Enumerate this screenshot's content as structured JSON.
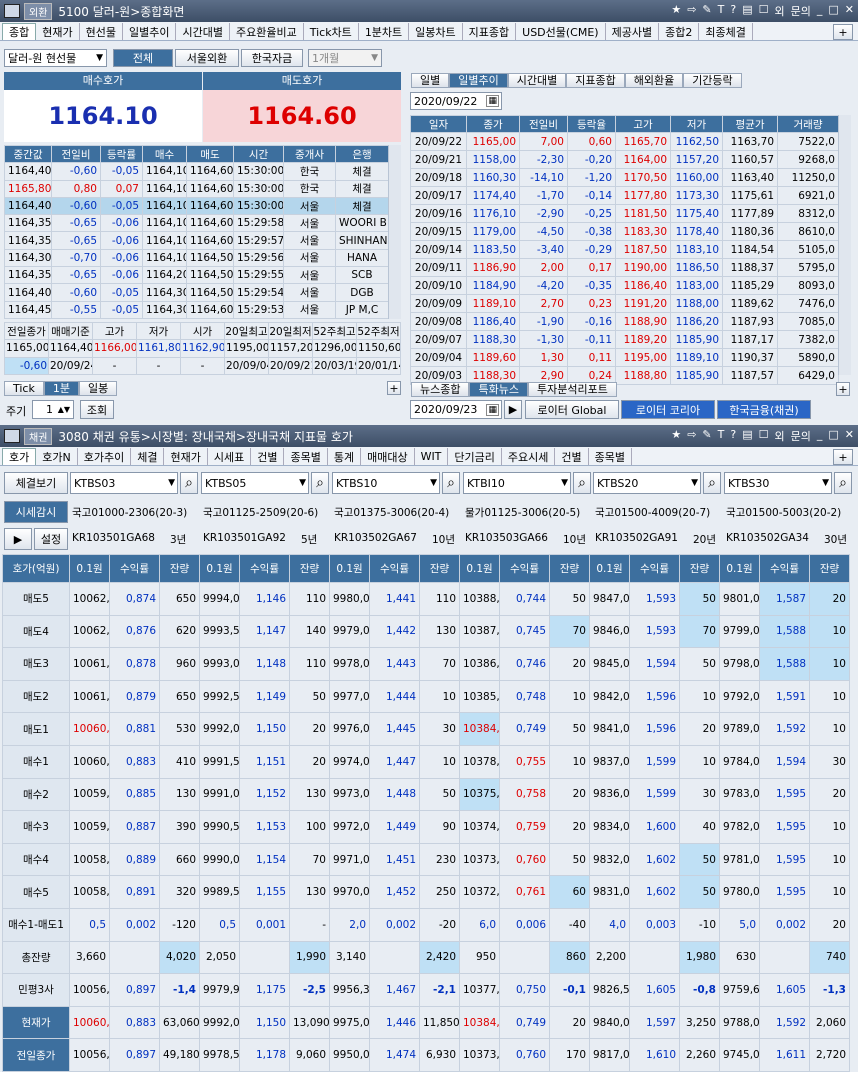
{
  "top": {
    "badge": "외환",
    "title": "5100 달러-원>종합화면",
    "icons": [
      "★",
      "⇨",
      "✎",
      "T",
      "?",
      "▤",
      "☐",
      "외",
      "문의",
      "_",
      "□",
      "✕"
    ],
    "tabs": [
      "종합",
      "현재가",
      "현선물",
      "일별추이",
      "시간대별",
      "주요환율비교",
      "Tick차트",
      "1분차트",
      "일봉차트",
      "지표종합",
      "USD선물(CME)",
      "제공사별",
      "종합2",
      "최종체결"
    ],
    "add": "+",
    "currency_select": "달러-원 현선물",
    "filters": [
      "전체",
      "서울외환",
      "한국자금"
    ],
    "period": "1개월",
    "bid_label": "매수호가",
    "ask_label": "매도호가",
    "bid": "1164.10",
    "ask": "1164.60",
    "ticks_headers": [
      "중간값",
      "전일비",
      "등락률",
      "매수",
      "매도",
      "시간",
      "중개사",
      "은행"
    ],
    "ticks": [
      [
        "1164,40",
        "-0,60",
        "-0,05",
        "1164,10",
        "1164,60",
        "15:30:00",
        "한국",
        "체결"
      ],
      [
        "1165,80",
        "0,80",
        "0,07",
        "1164,10",
        "1164,60",
        "15:30:00",
        "한국",
        "체결"
      ],
      [
        "1164,40",
        "-0,60",
        "-0,05",
        "1164,10",
        "1164,60",
        "15:30:00",
        "서울",
        "체결"
      ],
      [
        "1164,35",
        "-0,65",
        "-0,06",
        "1164,10",
        "1164,60",
        "15:29:58",
        "서울",
        "WOORI B"
      ],
      [
        "1164,35",
        "-0,65",
        "-0,06",
        "1164,10",
        "1164,60",
        "15:29:57",
        "서울",
        "SHINHAN"
      ],
      [
        "1164,30",
        "-0,70",
        "-0,06",
        "1164,10",
        "1164,50",
        "15:29:56",
        "서울",
        "HANA"
      ],
      [
        "1164,35",
        "-0,65",
        "-0,06",
        "1164,20",
        "1164,50",
        "15:29:55",
        "서울",
        "SCB"
      ],
      [
        "1164,40",
        "-0,60",
        "-0,05",
        "1164,30",
        "1164,50",
        "15:29:54",
        "서울",
        "DGB"
      ],
      [
        "1164,45",
        "-0,55",
        "-0,05",
        "1164,30",
        "1164,60",
        "15:29:53",
        "서울",
        "JP M,C"
      ]
    ],
    "summary_headers": [
      "전일종가",
      "매매기준",
      "고가",
      "저가",
      "시가",
      "20일최고",
      "20일최저",
      "52주최고",
      "52주최저"
    ],
    "summary_row1": [
      "1165,00",
      "1164,40",
      "1166,00",
      "1161,80",
      "1162,90",
      "1195,00",
      "1157,20",
      "1296,00",
      "1150,60"
    ],
    "summary_row2": [
      "-0,60",
      "20/09/24",
      "-",
      "-",
      "-",
      "20/09/04",
      "20/09/21",
      "20/03/19",
      "20/01/14"
    ],
    "bottom_tabs": [
      "Tick",
      "1분",
      "일봉"
    ],
    "cycle_label": "주기",
    "cycle_value": "1",
    "lookup": "조회",
    "right_tabs": [
      "일별",
      "일별추이",
      "시간대별",
      "지표종합",
      "해외환율",
      "기간등락"
    ],
    "date": "2020/09/22",
    "daily_headers": [
      "일자",
      "종가",
      "전일비",
      "등락율",
      "고가",
      "저가",
      "평균가",
      "거래량"
    ],
    "daily": [
      [
        "20/09/22",
        "1165,00",
        "7,00",
        "0,60",
        "1165,70",
        "1162,50",
        "1163,70",
        "7522,0"
      ],
      [
        "20/09/21",
        "1158,00",
        "-2,30",
        "-0,20",
        "1164,00",
        "1157,20",
        "1160,57",
        "9268,0"
      ],
      [
        "20/09/18",
        "1160,30",
        "-14,10",
        "-1,20",
        "1170,50",
        "1160,00",
        "1163,40",
        "11250,0"
      ],
      [
        "20/09/17",
        "1174,40",
        "-1,70",
        "-0,14",
        "1177,80",
        "1173,30",
        "1175,61",
        "6921,0"
      ],
      [
        "20/09/16",
        "1176,10",
        "-2,90",
        "-0,25",
        "1181,50",
        "1175,40",
        "1177,89",
        "8312,0"
      ],
      [
        "20/09/15",
        "1179,00",
        "-4,50",
        "-0,38",
        "1183,30",
        "1178,40",
        "1180,36",
        "8610,0"
      ],
      [
        "20/09/14",
        "1183,50",
        "-3,40",
        "-0,29",
        "1187,50",
        "1183,10",
        "1184,54",
        "5105,0"
      ],
      [
        "20/09/11",
        "1186,90",
        "2,00",
        "0,17",
        "1190,00",
        "1186,50",
        "1188,37",
        "5795,0"
      ],
      [
        "20/09/10",
        "1184,90",
        "-4,20",
        "-0,35",
        "1186,40",
        "1183,00",
        "1185,29",
        "8093,0"
      ],
      [
        "20/09/09",
        "1189,10",
        "2,70",
        "0,23",
        "1191,20",
        "1188,00",
        "1189,62",
        "7476,0"
      ],
      [
        "20/09/08",
        "1186,40",
        "-1,90",
        "-0,16",
        "1188,90",
        "1186,20",
        "1187,93",
        "7085,0"
      ],
      [
        "20/09/07",
        "1188,30",
        "-1,30",
        "-0,11",
        "1189,20",
        "1185,90",
        "1187,17",
        "7382,0"
      ],
      [
        "20/09/04",
        "1189,60",
        "1,30",
        "0,11",
        "1195,00",
        "1189,10",
        "1190,37",
        "5890,0"
      ],
      [
        "20/09/03",
        "1188,30",
        "2,90",
        "0,24",
        "1188,80",
        "1185,90",
        "1187,57",
        "6429,0"
      ]
    ],
    "news_tabs": [
      "뉴스종합",
      "특화뉴스",
      "투자분석리포트"
    ],
    "news_date": "2020/09/23",
    "news_sources": [
      "로이터 Global",
      "로이터 코리아",
      "한국금융(채권)"
    ]
  },
  "bond": {
    "badge": "채권",
    "title": "3080 채권 유통>시장별: 장내국채>장내국채 지표물 호가",
    "icons": [
      "★",
      "⇨",
      "✎",
      "T",
      "?",
      "▤",
      "☐",
      "외",
      "문의",
      "_",
      "□",
      "✕"
    ],
    "tabs": [
      "호가",
      "호가N",
      "호가추이",
      "체결",
      "현재가",
      "시세표",
      "건별",
      "종목별",
      "통계",
      "매매대상",
      "WIT",
      "단기금리",
      "주요시세",
      "건별",
      "종목별"
    ],
    "add": "+",
    "btn_settlement": "체결보기",
    "btn_monitor": "시세감시",
    "btn_setup": "설정",
    "play": "▶",
    "unit_label": "호가(억원)",
    "col_headers": [
      "0.1원",
      "수익률",
      "잔량"
    ],
    "row_labels": [
      "매도5",
      "매도4",
      "매도3",
      "매도2",
      "매도1",
      "매수1",
      "매수2",
      "매수3",
      "매수4",
      "매수5",
      "매수1-매도1",
      "총잔량",
      "민평3사",
      "현재가",
      "전일종가"
    ],
    "items": [
      {
        "code": "KTBS03",
        "name": "국고01000-2306(20-3)",
        "isin": "KR103501GA68",
        "tenor": "3년",
        "rows": [
          [
            "10062,5",
            "0,874",
            "650"
          ],
          [
            "10062,0",
            "0,876",
            "620"
          ],
          [
            "10061,5",
            "0,878",
            "960"
          ],
          [
            "10061,0",
            "0,879",
            "650"
          ],
          [
            "10060,5",
            "0,881",
            "530"
          ],
          [
            "10060,0",
            "0,883",
            "410"
          ],
          [
            "10059,5",
            "0,885",
            "130"
          ],
          [
            "10059,0",
            "0,887",
            "390"
          ],
          [
            "10058,5",
            "0,889",
            "660"
          ],
          [
            "10058,0",
            "0,891",
            "320"
          ],
          [
            "0,5",
            "0,002",
            "-120"
          ],
          [
            "3,660",
            "",
            "4,020"
          ],
          [
            "10056,1",
            "0,897",
            "-1,4"
          ],
          [
            "10060,0",
            "0,883",
            "63,060"
          ],
          [
            "10056,0",
            "0,897",
            "49,180"
          ]
        ]
      },
      {
        "code": "KTBS05",
        "name": "국고01125-2509(20-6)",
        "isin": "KR103501GA92",
        "tenor": "5년",
        "rows": [
          [
            "9994,0",
            "1,146",
            "110"
          ],
          [
            "9993,5",
            "1,147",
            "140"
          ],
          [
            "9993,0",
            "1,148",
            "110"
          ],
          [
            "9992,5",
            "1,149",
            "50"
          ],
          [
            "9992,0",
            "1,150",
            "20"
          ],
          [
            "9991,5",
            "1,151",
            "20"
          ],
          [
            "9991,0",
            "1,152",
            "130"
          ],
          [
            "9990,5",
            "1,153",
            "100"
          ],
          [
            "9990,0",
            "1,154",
            "70"
          ],
          [
            "9989,5",
            "1,155",
            "130"
          ],
          [
            "0,5",
            "0,001",
            "-"
          ],
          [
            "2,050",
            "",
            "1,990"
          ],
          [
            "9979,9",
            "1,175",
            "-2,5"
          ],
          [
            "9992,0",
            "1,150",
            "13,090"
          ],
          [
            "9978,5",
            "1,178",
            "9,060"
          ]
        ]
      },
      {
        "code": "KTBS10",
        "name": "국고01375-3006(20-4)",
        "isin": "KR103502GA67",
        "tenor": "10년",
        "rows": [
          [
            "9980,0",
            "1,441",
            "110"
          ],
          [
            "9979,0",
            "1,442",
            "130"
          ],
          [
            "9978,0",
            "1,443",
            "70"
          ],
          [
            "9977,0",
            "1,444",
            "10"
          ],
          [
            "9976,0",
            "1,445",
            "30"
          ],
          [
            "9974,0",
            "1,447",
            "10"
          ],
          [
            "9973,0",
            "1,448",
            "50"
          ],
          [
            "9972,0",
            "1,449",
            "90"
          ],
          [
            "9971,0",
            "1,451",
            "230"
          ],
          [
            "9970,0",
            "1,452",
            "250"
          ],
          [
            "2,0",
            "0,002",
            "-20"
          ],
          [
            "3,140",
            "",
            "2,420"
          ],
          [
            "9956,3",
            "1,467",
            "-2,1"
          ],
          [
            "9975,0",
            "1,446",
            "11,850"
          ],
          [
            "9950,0",
            "1,474",
            "6,930"
          ]
        ]
      },
      {
        "code": "KTBI10",
        "name": "물가01125-3006(20-5)",
        "isin": "KR103503GA66",
        "tenor": "10년",
        "rows": [
          [
            "10388,0",
            "0,744",
            "50"
          ],
          [
            "10387,0",
            "0,745",
            "70"
          ],
          [
            "10386,0",
            "0,746",
            "20"
          ],
          [
            "10385,0",
            "0,748",
            "10"
          ],
          [
            "10384,0",
            "0,749",
            "50"
          ],
          [
            "10378,0",
            "0,755",
            "10"
          ],
          [
            "10375,0",
            "0,758",
            "20"
          ],
          [
            "10374,0",
            "0,759",
            "20"
          ],
          [
            "10373,0",
            "0,760",
            "50"
          ],
          [
            "10372,0",
            "0,761",
            "60"
          ],
          [
            "6,0",
            "0,006",
            "-40"
          ],
          [
            "950",
            "",
            "860"
          ],
          [
            "10377,7",
            "0,750",
            "-0,1"
          ],
          [
            "10384,0",
            "0,749",
            "20"
          ],
          [
            "10373,0",
            "0,760",
            "170"
          ]
        ]
      },
      {
        "code": "KTBS20",
        "name": "국고01500-4009(20-7)",
        "isin": "KR103502GA91",
        "tenor": "20년",
        "rows": [
          [
            "9847,0",
            "1,593",
            "50"
          ],
          [
            "9846,0",
            "1,593",
            "70"
          ],
          [
            "9845,0",
            "1,594",
            "50"
          ],
          [
            "9842,0",
            "1,596",
            "10"
          ],
          [
            "9841,0",
            "1,596",
            "20"
          ],
          [
            "9837,0",
            "1,599",
            "10"
          ],
          [
            "9836,0",
            "1,599",
            "30"
          ],
          [
            "9834,0",
            "1,600",
            "40"
          ],
          [
            "9832,0",
            "1,602",
            "50"
          ],
          [
            "9831,0",
            "1,602",
            "50"
          ],
          [
            "4,0",
            "0,003",
            "-10"
          ],
          [
            "2,200",
            "",
            "1,980"
          ],
          [
            "9826,5",
            "1,605",
            "-0,8"
          ],
          [
            "9840,0",
            "1,597",
            "3,250"
          ],
          [
            "9817,0",
            "1,610",
            "2,260"
          ]
        ]
      },
      {
        "code": "KTBS30",
        "name": "국고01500-5003(20-2)",
        "isin": "KR103502GA34",
        "tenor": "30년",
        "rows": [
          [
            "9801,0",
            "1,587",
            "20"
          ],
          [
            "9799,0",
            "1,588",
            "10"
          ],
          [
            "9798,0",
            "1,588",
            "10"
          ],
          [
            "9792,0",
            "1,591",
            "10"
          ],
          [
            "9789,0",
            "1,592",
            "10"
          ],
          [
            "9784,0",
            "1,594",
            "30"
          ],
          [
            "9783,0",
            "1,595",
            "20"
          ],
          [
            "9782,0",
            "1,595",
            "10"
          ],
          [
            "9781,0",
            "1,595",
            "10"
          ],
          [
            "9780,0",
            "1,595",
            "10"
          ],
          [
            "5,0",
            "0,002",
            "20"
          ],
          [
            "630",
            "",
            "740"
          ],
          [
            "9759,6",
            "1,605",
            "-1,3"
          ],
          [
            "9788,0",
            "1,592",
            "2,060"
          ],
          [
            "9745,0",
            "1,611",
            "2,720"
          ]
        ]
      }
    ]
  }
}
